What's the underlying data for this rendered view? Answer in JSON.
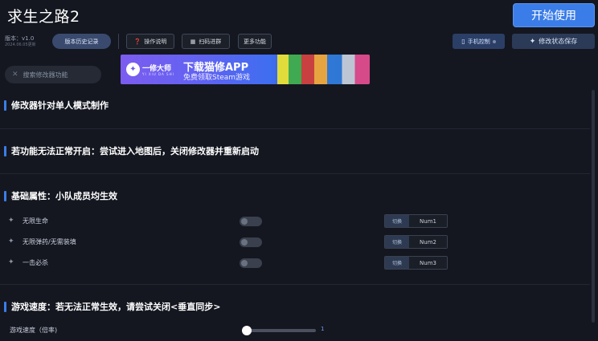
{
  "app": {
    "title": "求生之路2",
    "start_button": "开始使用",
    "version_label": "版本：v1.0",
    "version_date": "2024.06.05更新"
  },
  "toolbar": {
    "history_button": "版本历史记录",
    "guide_button": "操作说明",
    "scan_button": "扫码进群",
    "more_button": "更多功能",
    "phone_control": "手机控制",
    "save_state": "修改状态保存"
  },
  "search": {
    "placeholder": "搜索修改器功能"
  },
  "banner": {
    "brand": "一修大师",
    "brand_sub": "YI XIU DA SHI",
    "headline": "下载猫修APP",
    "subline": "免费领取Steam游戏"
  },
  "sections": {
    "notice1": "修改器针对单人模式制作",
    "notice2": "若功能无法正常开启：尝试进入地图后，关闭修改器并重新启动",
    "basic": "基础属性：小队成员均生效",
    "speed": "游戏速度：若无法正常生效，请尝试关闭<垂直同步>"
  },
  "features": [
    {
      "label": "无限生命",
      "switch_label": "切换",
      "hotkey": "Num1",
      "enabled": false
    },
    {
      "label": "无限弹药/无需装填",
      "switch_label": "切换",
      "hotkey": "Num2",
      "enabled": false
    },
    {
      "label": "一击必杀",
      "switch_label": "切换",
      "hotkey": "Num3",
      "enabled": false
    }
  ],
  "speed": {
    "label": "游戏速度（倍率)",
    "value": "1",
    "fraction": 0.05
  },
  "colors": {
    "accent": "#3b7de8",
    "background": "#141720"
  },
  "icons": {
    "guide": "question-circle-icon",
    "scan": "qr-code-icon",
    "phone": "phone-icon",
    "save": "sparkle-icon",
    "search": "cross-tools-icon",
    "feature": "sparkle-icon"
  }
}
